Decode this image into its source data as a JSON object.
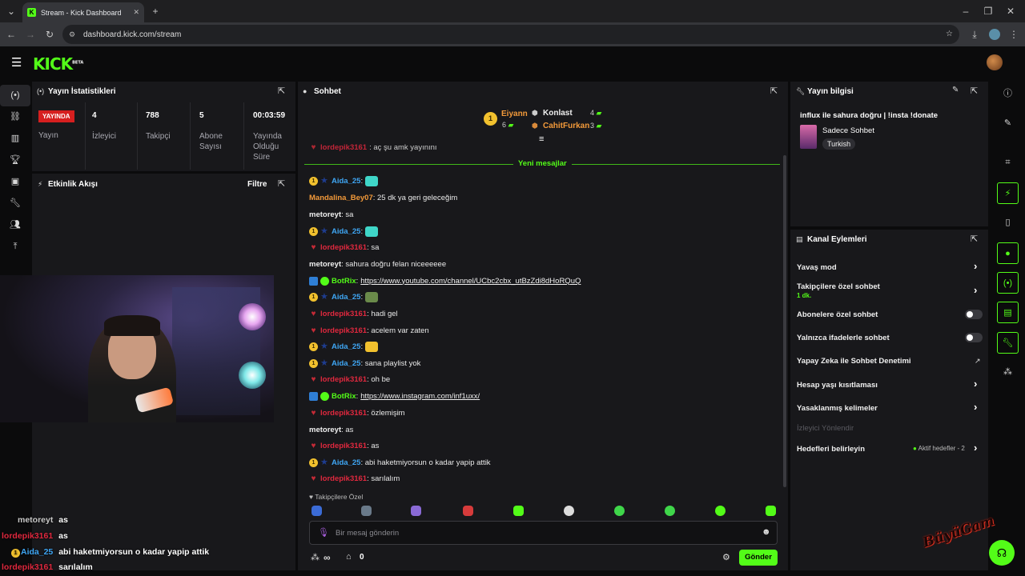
{
  "browser": {
    "tab_title": "Stream - Kick Dashboard",
    "url": "dashboard.kick.com/stream"
  },
  "app": {
    "logo": "KICK",
    "logo_sup": "BETA"
  },
  "stats": {
    "title": "Yayın İstatistikleri",
    "live_badge": "YAYINDA",
    "live_label": "Yayın",
    "viewers_value": "4",
    "viewers_label": "İzleyici",
    "followers_value": "788",
    "followers_label": "Takipçi",
    "subs_value": "5",
    "subs_label": "Abone Sayısı",
    "duration_value": "00:03:59",
    "duration_label": "Yayında Olduğu Süre"
  },
  "activity": {
    "title": "Etkinlik Akışı",
    "filter": "Filtre"
  },
  "chat": {
    "title": "Sohbet",
    "leaderboard": {
      "first_name": "Eiyann",
      "first_count": "6",
      "second_name": "Konlast",
      "second_count": "4",
      "third_name": "CahitFurkan",
      "third_count": "3"
    },
    "partial_top": {
      "user": "lordepik3161",
      "text": ": aç şu amk yayınını"
    },
    "new_messages": "Yeni mesajlar",
    "messages": [
      {
        "user": "Aida_25",
        "text": ":",
        "color": "blue"
      },
      {
        "user": "Mandalina_Bey07",
        "text": ": 25 dk ya geri geleceğim",
        "color": "orange"
      },
      {
        "user": "metoreyt",
        "text": ": sa",
        "color": "white"
      },
      {
        "user": "Aida_25",
        "text": ":",
        "color": "blue"
      },
      {
        "user": "lordepik3161",
        "text": ": sa",
        "color": "red"
      },
      {
        "user": "metoreyt",
        "text": ": sahura doğru felan niceeeeee",
        "color": "white"
      },
      {
        "user": "BotRix",
        "text": ":",
        "link": "https://www.youtube.com/channel/UCbc2cbx_utBzZdi8dHoRQuQ",
        "color": "green"
      },
      {
        "user": "Aida_25",
        "text": ":",
        "color": "blue"
      },
      {
        "user": "lordepik3161",
        "text": ": hadi gel",
        "color": "red"
      },
      {
        "user": "lordepik3161",
        "text": ": acelem var zaten",
        "color": "red"
      },
      {
        "user": "Aida_25",
        "text": ":",
        "color": "blue"
      },
      {
        "user": "Aida_25",
        "text": ": sana playlist yok",
        "color": "blue"
      },
      {
        "user": "lordepik3161",
        "text": ": oh be",
        "color": "red"
      },
      {
        "user": "BotRix",
        "text": ":",
        "link": "https://www.instagram.com/inf1uxx/",
        "color": "green"
      },
      {
        "user": "lordepik3161",
        "text": ": özlemişim",
        "color": "red"
      },
      {
        "user": "metoreyt",
        "text": ": as",
        "color": "white"
      },
      {
        "user": "lordepik3161",
        "text": ": as",
        "color": "red"
      },
      {
        "user": "Aida_25",
        "text": ": abi haketmiyorsun o kadar yapip attik",
        "color": "blue"
      },
      {
        "user": "lordepik3161",
        "text": ": sarılalım",
        "color": "red"
      }
    ],
    "follower_only": "Takipçilere Özel",
    "input_placeholder": "Bir mesaj gönderin",
    "points": "∞",
    "count": "0",
    "send": "Gönder"
  },
  "stream_info": {
    "title": "Yayın bilgisi",
    "stream_title": "influx ile sahura doğru | !insta !donate",
    "category": "Sadece Sohbet",
    "language": "Turkish"
  },
  "channel_actions": {
    "title": "Kanal Eylemleri",
    "slow_mode": "Yavaş mod",
    "followers_chat": "Takipçilere özel sohbet",
    "followers_chat_sub": "1 dk.",
    "subs_chat": "Abonelere özel sohbet",
    "emote_chat": "Yalnızca ifadelerle sohbet",
    "ai_moderation": "Yapay Zeka ile Sohbet Denetimi",
    "account_age": "Hesap yaşı kısıtlaması",
    "banned_words": "Yasaklanmış kelimeler",
    "viewer_redirect": "İzleyici Yönlendir",
    "set_goals": "Hedefleri belirleyin",
    "active_goals": "Aktif hedefler - 2"
  },
  "overlay_chat": [
    {
      "user": "metoreyt",
      "text": "as",
      "color": "#c8c8c8"
    },
    {
      "user": "lordepik3161",
      "text": "as",
      "color": "#e0283e"
    },
    {
      "user": "Aida_25",
      "text": "abi haketmiyorsun o kadar yapip attik",
      "color": "#3fa6f4"
    },
    {
      "user": "lordepik3161",
      "text": "sarılalım",
      "color": "#e0283e"
    }
  ],
  "watermark": "BüyüGam"
}
